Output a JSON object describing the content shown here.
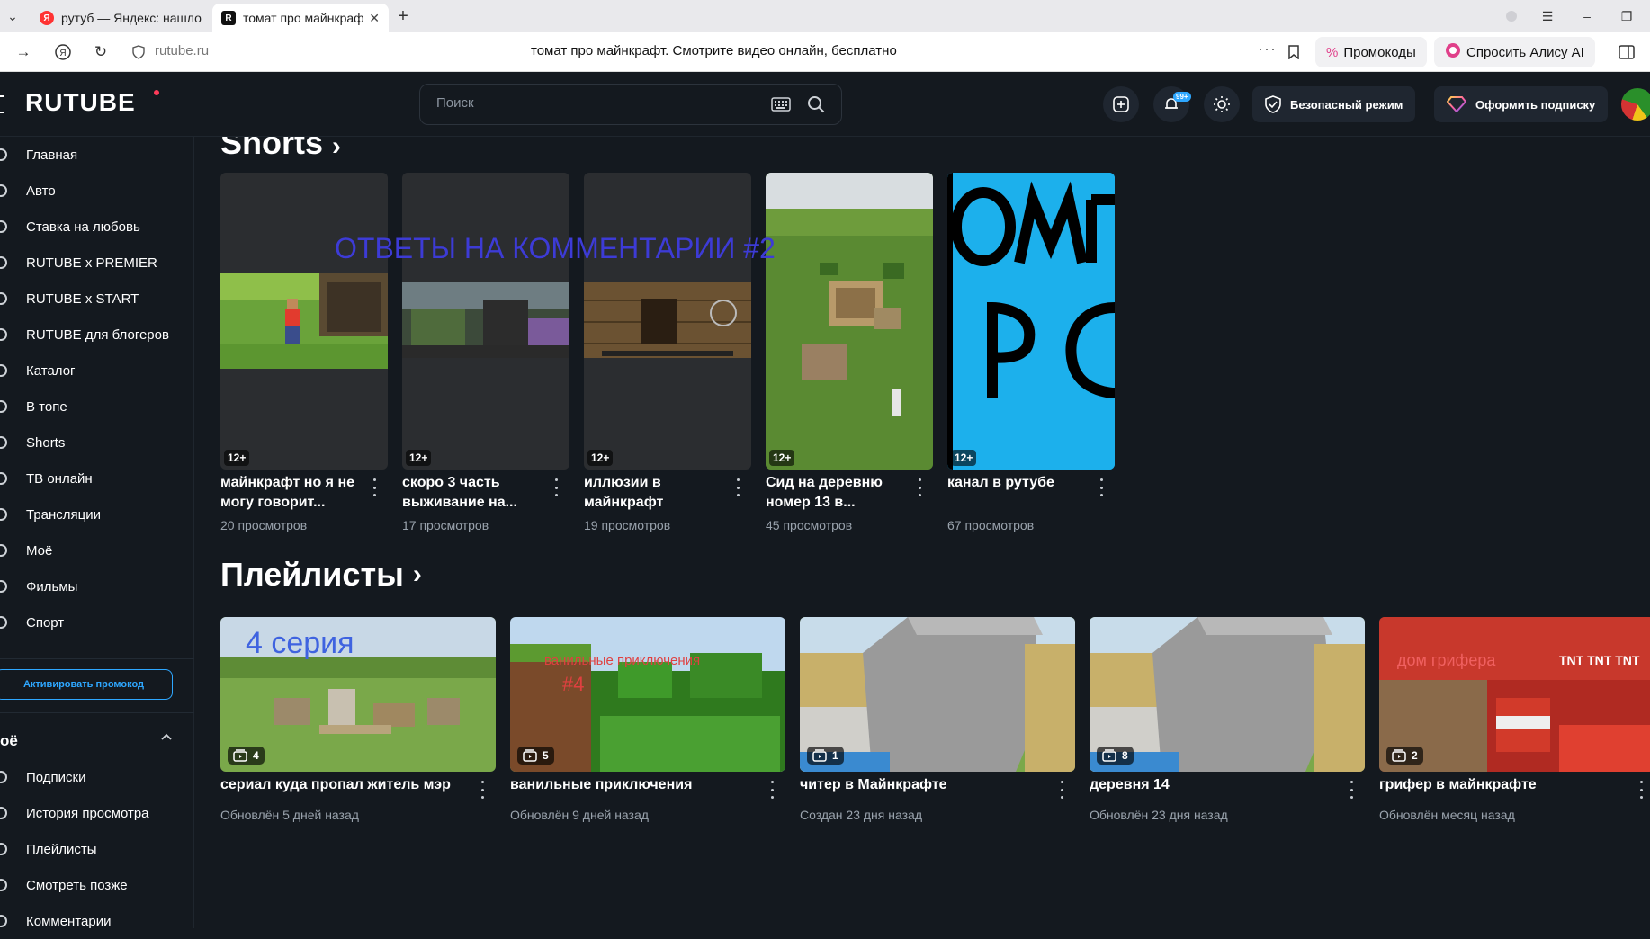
{
  "browser": {
    "tabs": [
      {
        "label": "рутуб — Яндекс: нашлось",
        "favicon": "Я"
      },
      {
        "label": "томат про майнкрафт.",
        "favicon": "R"
      }
    ],
    "url_host": "rutube.ru",
    "page_title": "томат про майнкрафт. Смотрите видео онлайн, бесплатно",
    "promo_codes": "Промокоды",
    "ask_alice": "Спросить Алису AI"
  },
  "header": {
    "logo": "RUTUBE",
    "search_placeholder": "Поиск",
    "notifications_badge": "99+",
    "safe_mode": "Безопасный режим",
    "subscribe": "Оформить подписку"
  },
  "sidebar": {
    "items": [
      {
        "label": "Главная"
      },
      {
        "label": "Авто"
      },
      {
        "label": "Ставка на любовь"
      },
      {
        "label": "RUTUBE x PREMIER"
      },
      {
        "label": "RUTUBE x START"
      },
      {
        "label": "RUTUBE для блогеров"
      },
      {
        "label": "Каталог"
      },
      {
        "label": "В топе"
      },
      {
        "label": "Shorts"
      },
      {
        "label": "ТВ онлайн"
      },
      {
        "label": "Трансляции"
      },
      {
        "label": "Моё"
      },
      {
        "label": "Фильмы"
      },
      {
        "label": "Спорт"
      }
    ],
    "promo_button": "Активировать промокод",
    "section_title": "оё",
    "section_items": [
      {
        "label": "Подписки"
      },
      {
        "label": "История просмотра"
      },
      {
        "label": "Плейлисты"
      },
      {
        "label": "Смотреть позже"
      },
      {
        "label": "Комментарии"
      }
    ]
  },
  "main": {
    "shorts_title": "Shorts",
    "overlay_text": "ОТВЕТЫ НА КОММЕНТАРИИ #2",
    "shorts": [
      {
        "title": "майнкрафт но я не могу говорит...",
        "views": "20 просмотров",
        "age": "12+"
      },
      {
        "title": "скоро 3 часть выживание на...",
        "views": "17 просмотров",
        "age": "12+"
      },
      {
        "title": "иллюзии в майнкрафт",
        "views": "19 просмотров",
        "age": "12+"
      },
      {
        "title": "Сид на деревню номер 13 в...",
        "views": "45 просмотров",
        "age": "12+"
      },
      {
        "title": "канал в рутубе",
        "views": "67 просмотров",
        "age": "12+"
      }
    ],
    "playlists_title": "Плейлисты",
    "playlists": [
      {
        "title": "сериал куда пропал житель мэр",
        "updated": "Обновлён 5 дней назад",
        "count": "4",
        "thumb_text": "4 серия"
      },
      {
        "title": "ванильные приключения",
        "updated": "Обновлён 9 дней назад",
        "count": "5",
        "thumb_text": "ванильные приключения",
        "thumb_text2": "#4"
      },
      {
        "title": "читер в Майнкрафте",
        "updated": "Создан 23 дня назад",
        "count": "1"
      },
      {
        "title": "деревня 14",
        "updated": "Обновлён 23 дня назад",
        "count": "8"
      },
      {
        "title": "грифер в майнкрафте",
        "updated": "Обновлён месяц назад",
        "count": "2",
        "thumb_text": "дом грифера",
        "thumb_text2": "TNT TNT TNT"
      }
    ]
  }
}
